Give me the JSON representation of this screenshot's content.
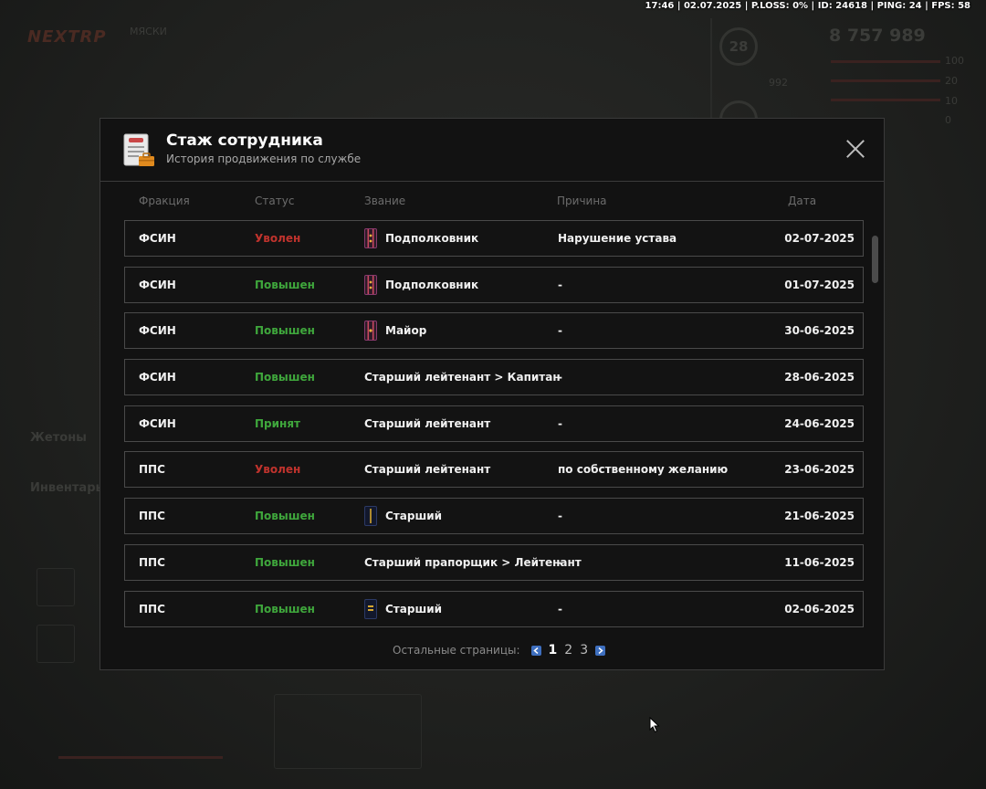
{
  "status_bar": "17:46 | 02.07.2025 | P.LOSS: 0% | ID: 24618 | PING: 24 | FPS: 58",
  "background": {
    "logo_a": "NEXT",
    "logo_b": "RP",
    "sub_1": "МЯСКИ",
    "sub_2": "",
    "level": "28",
    "money": "8 757 989",
    "stats": [
      "100",
      "20",
      "10",
      "0",
      "992"
    ],
    "side_1": "Жетоны",
    "side_2": "Инвентарь"
  },
  "modal": {
    "title": "Стаж сотрудника",
    "subtitle": "История продвижения по службе",
    "icon": "document-briefcase-icon",
    "columns": {
      "faction": "Фракция",
      "status": "Статус",
      "rank": "Звание",
      "reason": "Причина",
      "date": "Дата"
    },
    "rows": [
      {
        "faction": "ФСИН",
        "status": "Уволен",
        "status_color": "red",
        "rank": "Подполковник",
        "rank_icon": "lt-colonel",
        "reason": "Нарушение устава",
        "date": "02-07-2025"
      },
      {
        "faction": "ФСИН",
        "status": "Повышен",
        "status_color": "green",
        "rank": "Подполковник",
        "rank_icon": "lt-colonel",
        "reason": "-",
        "date": "01-07-2025"
      },
      {
        "faction": "ФСИН",
        "status": "Повышен",
        "status_color": "green",
        "rank": "Майор",
        "rank_icon": "major",
        "reason": "-",
        "date": "30-06-2025"
      },
      {
        "faction": "ФСИН",
        "status": "Повышен",
        "status_color": "green",
        "rank": "Старший лейтенант > Капитан",
        "rank_icon": "",
        "reason": "-",
        "date": "28-06-2025"
      },
      {
        "faction": "ФСИН",
        "status": "Принят",
        "status_color": "green",
        "rank": "Старший лейтенант",
        "rank_icon": "",
        "reason": "-",
        "date": "24-06-2025"
      },
      {
        "faction": "ППС",
        "status": "Уволен",
        "status_color": "red",
        "rank": "Старший лейтенант",
        "rank_icon": "",
        "reason": "по собственному желанию",
        "date": "23-06-2025"
      },
      {
        "faction": "ППС",
        "status": "Повышен",
        "status_color": "green",
        "rank": "Старший",
        "rank_icon": "senior-navy",
        "reason": "-",
        "date": "21-06-2025"
      },
      {
        "faction": "ППС",
        "status": "Повышен",
        "status_color": "green",
        "rank": "Старший прапорщик > Лейтенант",
        "rank_icon": "",
        "reason": "-",
        "date": "11-06-2025"
      },
      {
        "faction": "ППС",
        "status": "Повышен",
        "status_color": "green",
        "rank": "Старший",
        "rank_icon": "senior-gold",
        "reason": "-",
        "date": "02-06-2025"
      }
    ],
    "pager": {
      "label": "Остальные страницы:",
      "pages": [
        "1",
        "2",
        "3"
      ],
      "active": "1"
    }
  },
  "colors": {
    "status_red": "#c0332d",
    "status_green": "#3fa73c",
    "pager_arrow": "#3e6fbf"
  }
}
